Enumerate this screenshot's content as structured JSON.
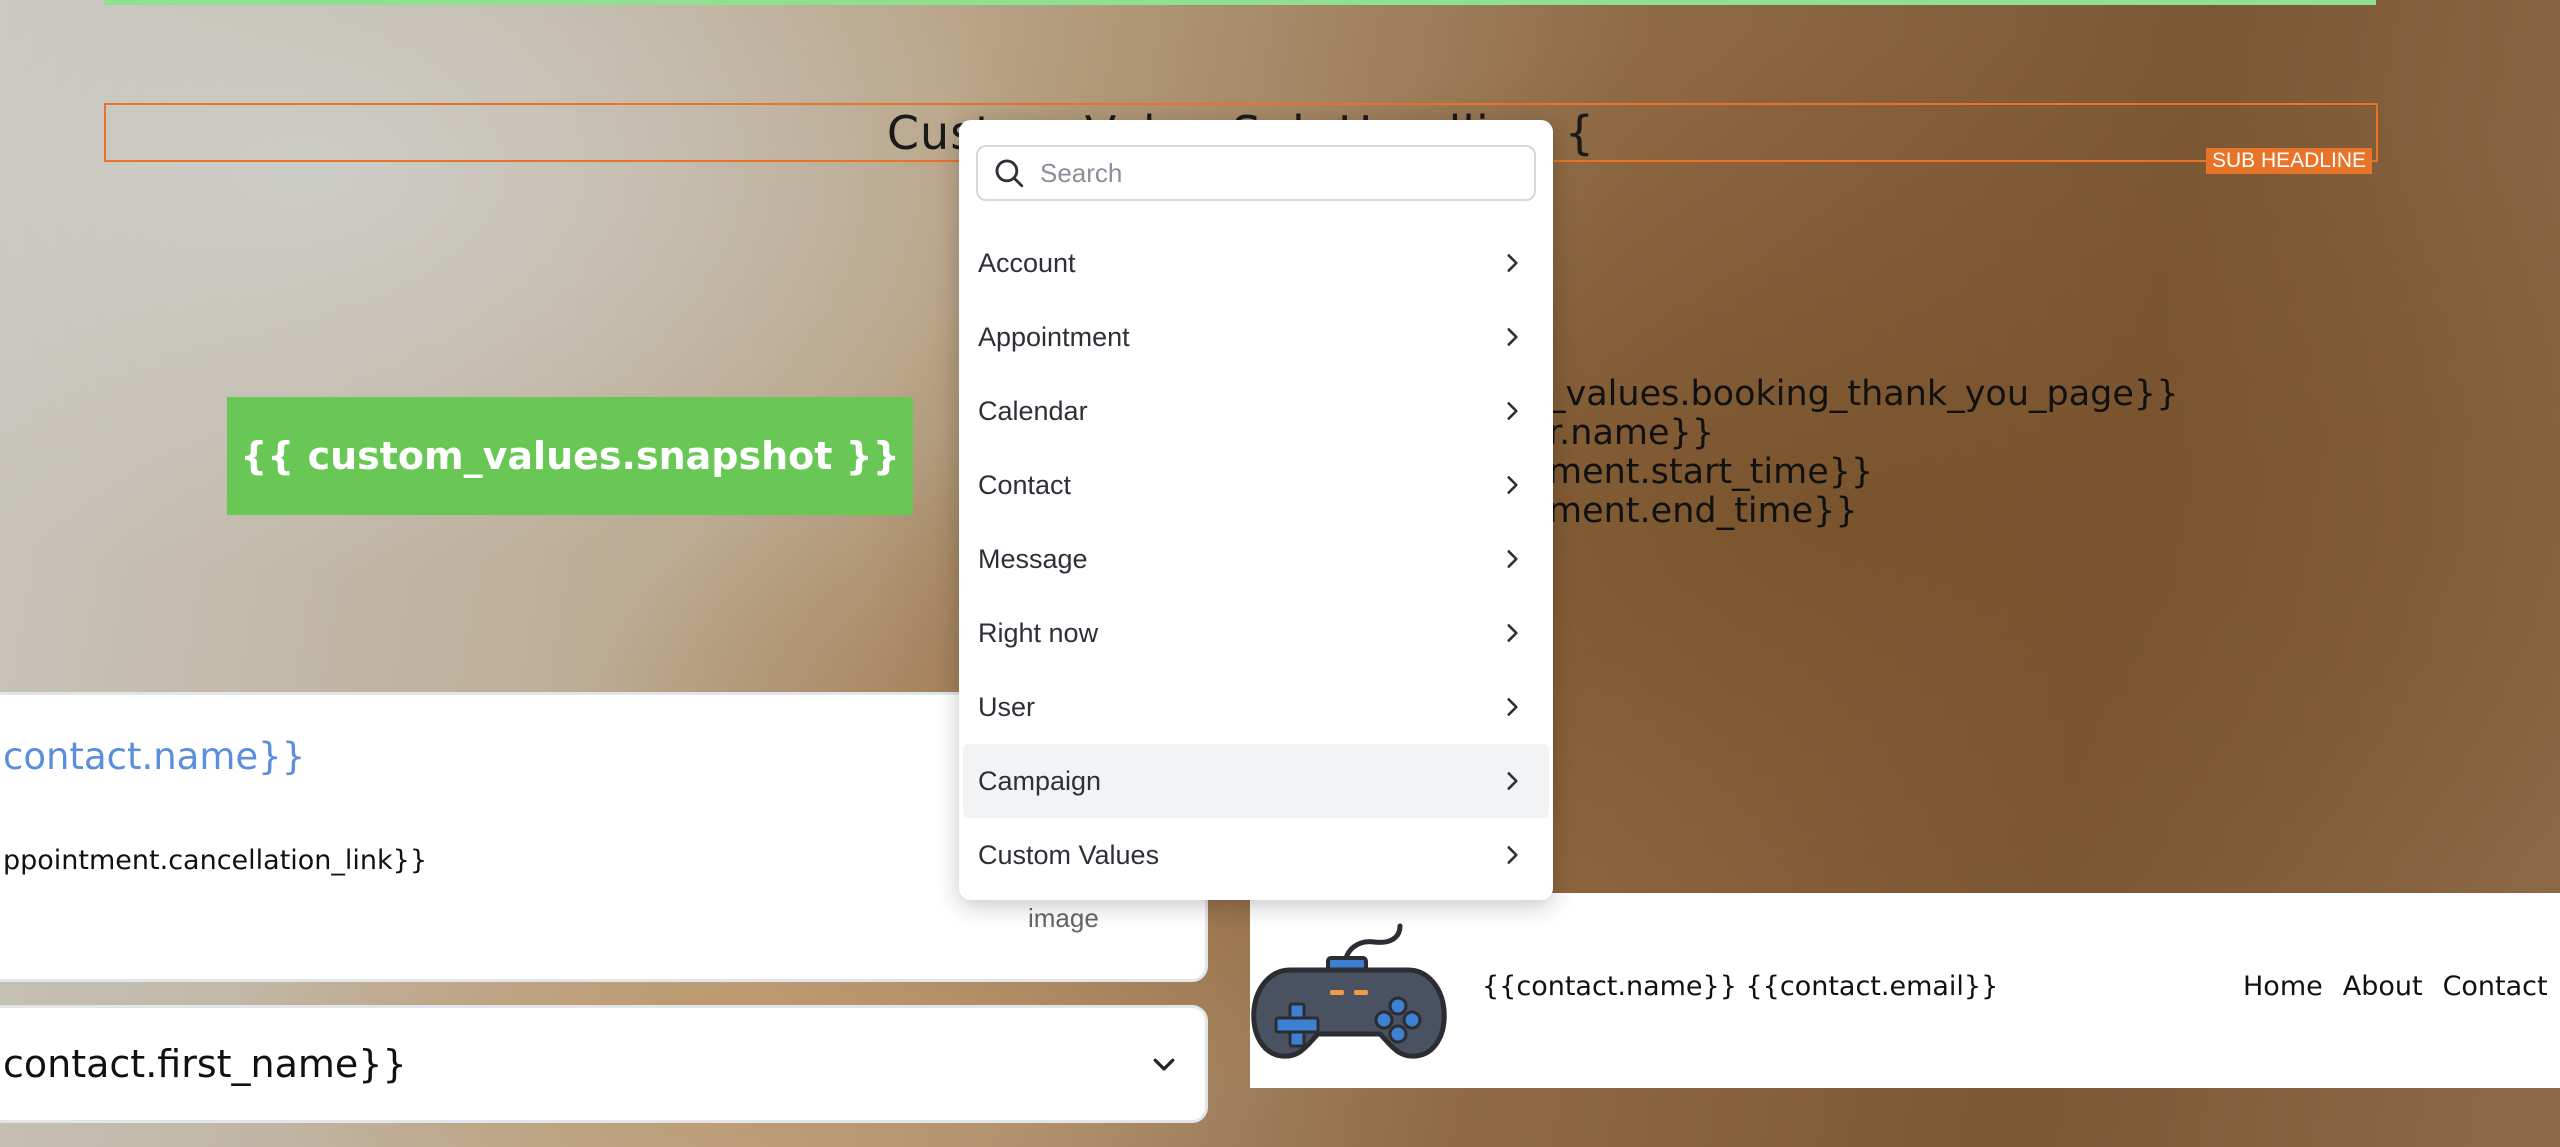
{
  "page": {
    "sub_headline_text": "Custom Value Sub Headline {",
    "sub_headline_badge": "SUB HEADLINE",
    "snapshot_button_label": "{{ custom_values.snapshot }}",
    "text_lines": [
      "_values.booking_thank_you_page}}",
      "r.name}}",
      "ment.start_time}}",
      "ment.end_time}}"
    ],
    "card": {
      "contact_name_link": "contact.name}}",
      "cancellation_link": "ppointment.cancellation_link}}",
      "image_label": "image"
    },
    "select": {
      "value": "contact.first_name}}",
      "icon": "chevron-down-icon"
    },
    "nav": {
      "logo_icon": "gamepad-icon",
      "contact_info": "{{contact.name}} {{contact.email}}",
      "links": [
        "Home",
        "About",
        "Contact"
      ]
    }
  },
  "dropdown": {
    "search_placeholder": "Search",
    "items": [
      {
        "label": "Account"
      },
      {
        "label": "Appointment"
      },
      {
        "label": "Calendar"
      },
      {
        "label": "Contact"
      },
      {
        "label": "Message"
      },
      {
        "label": "Right now"
      },
      {
        "label": "User"
      },
      {
        "label": "Campaign",
        "highlighted": true
      },
      {
        "label": "Custom Values"
      }
    ]
  },
  "colors": {
    "accent_orange": "#e8742a",
    "button_green": "#69c855",
    "link_blue": "#5b8fdc",
    "hover_gray": "#f2f3f5"
  }
}
